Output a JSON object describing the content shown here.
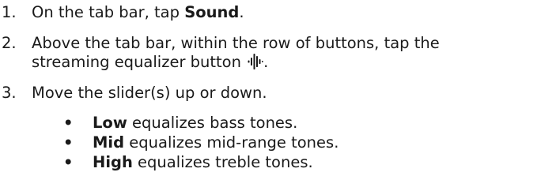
{
  "steps": [
    {
      "number": "1.",
      "prefix": "On the tab bar, tap ",
      "bold": "Sound",
      "suffix": "."
    },
    {
      "number": "2.",
      "line1": "Above the tab bar, within the row of buttons, tap the",
      "line2_prefix": "streaming equalizer button ",
      "icon": "streaming-equalizer-icon",
      "line2_suffix": "."
    },
    {
      "number": "3.",
      "text": "Move the slider(s) up or down."
    }
  ],
  "bullets": [
    {
      "marker": "•",
      "bold": "Low",
      "text": " equalizes bass tones."
    },
    {
      "marker": "•",
      "bold": "Mid",
      "text": " equalizes mid-range tones."
    },
    {
      "marker": "•",
      "bold": "High",
      "text": " equalizes treble tones."
    }
  ]
}
